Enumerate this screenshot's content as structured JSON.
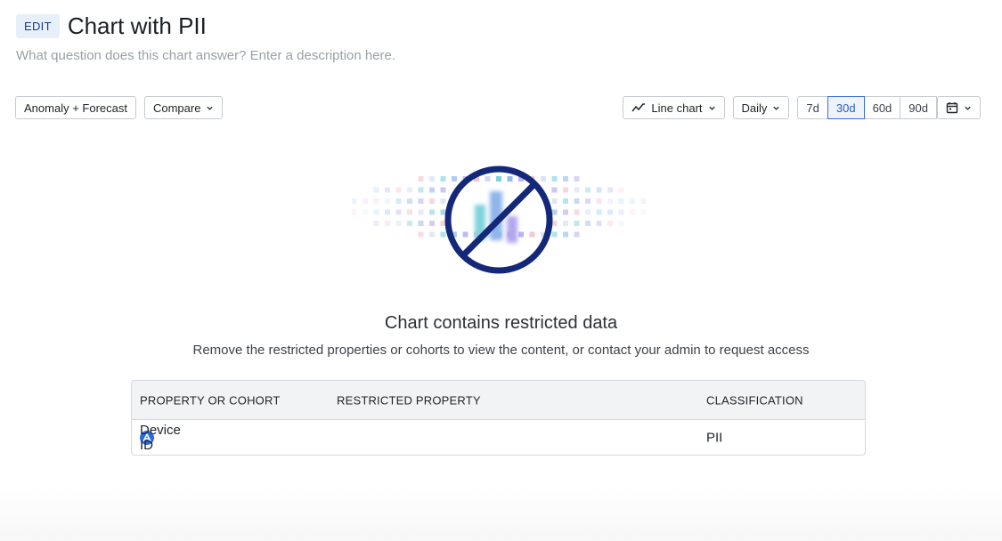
{
  "header": {
    "badge": "EDIT",
    "title": "Chart with PII",
    "description_placeholder": "What question does this chart answer? Enter a description here."
  },
  "toolbar": {
    "anomaly_label": "Anomaly + Forecast",
    "compare_label": "Compare",
    "chart_type_label": "Line chart",
    "interval_label": "Daily",
    "ranges": [
      "7d",
      "30d",
      "60d",
      "90d"
    ],
    "active_range": "30d",
    "icons": [
      "line-chart-icon",
      "chevron-down-icon",
      "calendar-icon"
    ]
  },
  "message": {
    "title": "Chart contains restricted data",
    "subtitle": "Remove the restricted properties or cohorts to view the content, or contact your admin to request access",
    "icon": "restricted-chart-icon"
  },
  "table": {
    "columns": [
      "PROPERTY OR COHORT",
      "RESTRICTED PROPERTY",
      "CLASSIFICATION"
    ],
    "rows": [
      {
        "property": "Device ID",
        "restricted": "",
        "classification": "PII",
        "icon": "amplitude-property-icon"
      }
    ]
  },
  "colors": {
    "accent": "#2a5cc5",
    "restricted_circle": "#14287a",
    "badge_bg": "#e6effa"
  }
}
